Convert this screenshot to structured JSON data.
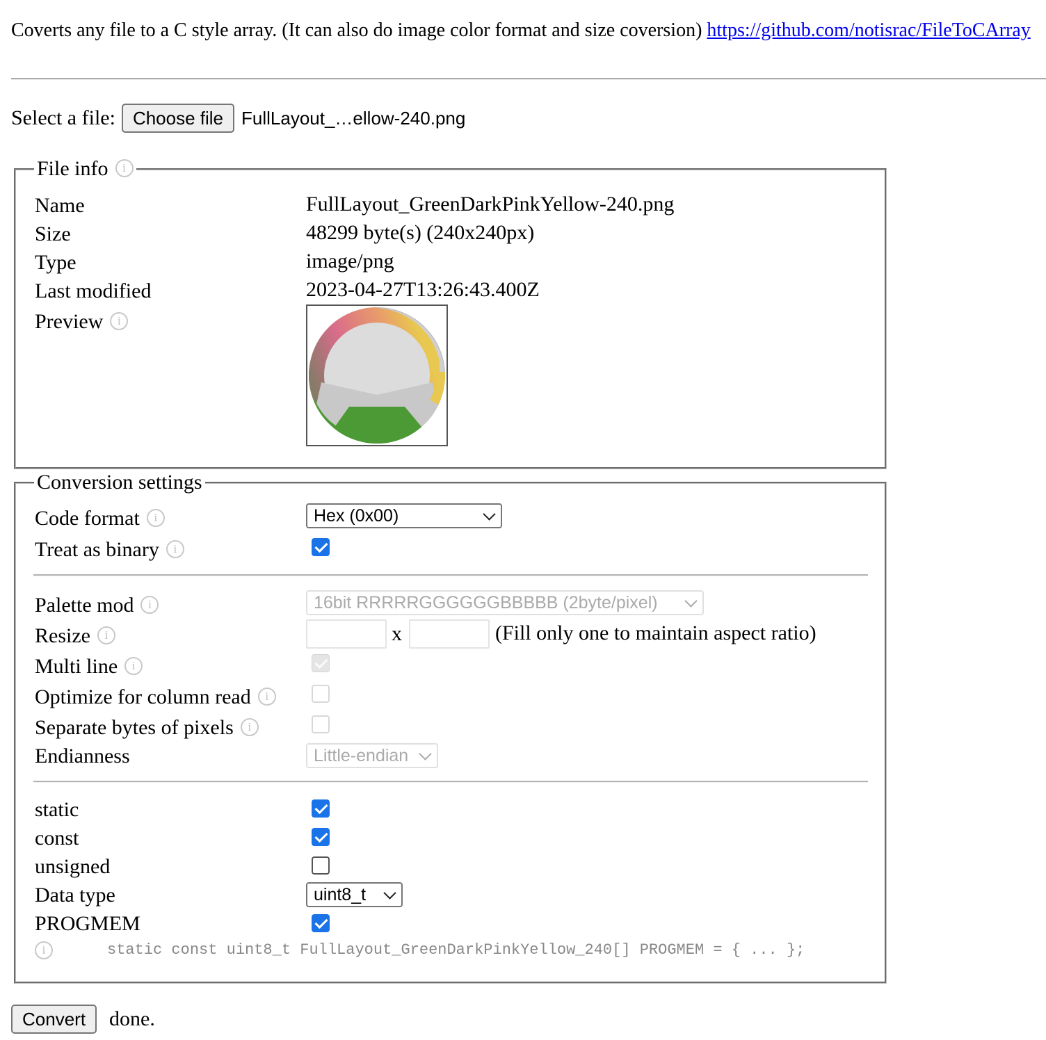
{
  "intro": {
    "text": "Coverts any file to a C style array. (It can also do image color format and size coversion)",
    "link": "https://github.com/notisrac/FileToCArray"
  },
  "file_select": {
    "label": "Select a file:",
    "button_label": "Choose file",
    "chosen_name": "FullLayout_…ellow-240.png"
  },
  "file_info": {
    "legend": "File info",
    "info_icon": "i",
    "rows": [
      {
        "label": "Name",
        "value": "FullLayout_GreenDarkPinkYellow-240.png"
      },
      {
        "label": "Size",
        "value": "48299 byte(s) (240x240px)"
      },
      {
        "label": "Type",
        "value": "image/png"
      },
      {
        "label": "Last modified",
        "value": "2023-04-27T13:26:43.400Z"
      },
      {
        "label": "Preview",
        "value": ""
      }
    ]
  },
  "conversion": {
    "legend": "Conversion settings",
    "code_format": {
      "label": "Code format",
      "value": "Hex (0x00)"
    },
    "treat_as_binary": {
      "label": "Treat as binary",
      "checked": true
    },
    "palette_mod": {
      "label": "Palette mod",
      "value": "16bit RRRRRGGGGGGBBBBB (2byte/pixel)",
      "disabled": true
    },
    "resize": {
      "label": "Resize",
      "x_sep": "x",
      "hint": "(Fill only one to maintain aspect ratio)",
      "width": "",
      "height": ""
    },
    "multi_line": {
      "label": "Multi line",
      "checked": true,
      "disabled": true
    },
    "optimize_column": {
      "label": "Optimize for column read",
      "checked": false,
      "disabled": true
    },
    "separate_bytes": {
      "label": "Separate bytes of pixels",
      "checked": false,
      "disabled": true
    },
    "endianness": {
      "label": "Endianness",
      "value": "Little-endian",
      "disabled": true
    },
    "static": {
      "label": "static",
      "checked": true
    },
    "const": {
      "label": "const",
      "checked": true
    },
    "unsigned": {
      "label": "unsigned",
      "checked": false
    },
    "data_type": {
      "label": "Data type",
      "value": "uint8_t"
    },
    "progmem": {
      "label": "PROGMEM",
      "checked": true
    },
    "declaration": "static const uint8_t FullLayout_GreenDarkPinkYellow_240[] PROGMEM = { ... };"
  },
  "convert": {
    "button_label": "Convert",
    "status": "done."
  },
  "colors": {
    "link": "#0000ee",
    "checkbox_on": "#1a73e8",
    "preview_green": "#4c9a36",
    "preview_gray": "#d6d6d6"
  }
}
